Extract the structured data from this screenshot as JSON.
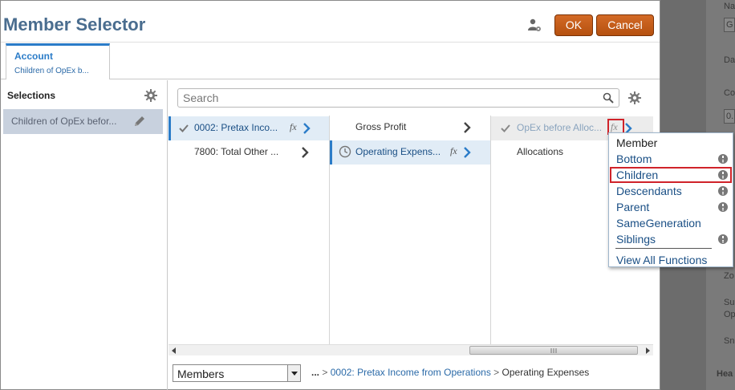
{
  "dialog": {
    "title": "Member Selector",
    "ok_label": "OK",
    "cancel_label": "Cancel"
  },
  "tab": {
    "label": "Account",
    "subtitle": "Children of OpEx b..."
  },
  "selections": {
    "label": "Selections",
    "items": [
      {
        "label": "Children of OpEx befor..."
      }
    ]
  },
  "search": {
    "placeholder": "Search",
    "value": ""
  },
  "columns": [
    {
      "rows": [
        {
          "label": "0002: Pretax Inco...",
          "state": "selected-checked",
          "has_fx": true,
          "fx_label": "fx"
        },
        {
          "label": "7800: Total Other ...",
          "state": "normal",
          "has_fx": false
        }
      ]
    },
    {
      "rows": [
        {
          "label": "Gross Profit",
          "state": "normal",
          "has_fx": false
        },
        {
          "label": "Operating Expens...",
          "state": "active-clock",
          "has_fx": true,
          "fx_label": "fx"
        }
      ]
    },
    {
      "rows": [
        {
          "label": "OpEx before Alloc...",
          "state": "muted-checked",
          "has_fx": true,
          "fx_label": "fx"
        },
        {
          "label": "Allocations",
          "state": "normal",
          "has_fx": false
        }
      ]
    }
  ],
  "function_menu": {
    "header": "Member",
    "items": [
      {
        "label": "Bottom",
        "has_info": true
      },
      {
        "label": "Children",
        "has_info": true,
        "highlighted": true
      },
      {
        "label": "Descendants",
        "has_info": true
      },
      {
        "label": "Parent",
        "has_info": true
      },
      {
        "label": "SameGeneration",
        "has_info": false
      },
      {
        "label": "Siblings",
        "has_info": true
      }
    ],
    "footer": "View All Functions"
  },
  "bottom": {
    "dimension_select": "Members",
    "breadcrumb": {
      "ellipsis": "...",
      "separator": ">",
      "link": "0002: Pretax Income from Operations",
      "current": "Operating Expenses"
    }
  },
  "background_panel": {
    "labels": [
      "Na",
      "G",
      "Da",
      "Co",
      "0.",
      "Zo",
      "Su",
      "Op",
      "Sn",
      "Hea"
    ]
  },
  "colors": {
    "accent": "#2b7cc8",
    "title": "#4a6d8f",
    "button": "#c0581a",
    "highlight_box": "#d0232a"
  }
}
